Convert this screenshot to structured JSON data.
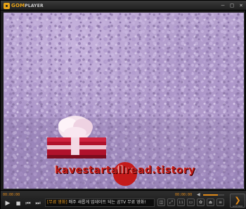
{
  "app": {
    "logo_main": "GOM",
    "logo_sub": "PLAYER"
  },
  "window_controls": {
    "minimize": "–",
    "maximize": "□",
    "close": "×"
  },
  "video": {
    "watermark": "kavestartallread.tistory"
  },
  "player": {
    "time_elapsed": "00:00:00",
    "time_total": "00:00:00",
    "volume_level": 0.7,
    "ticker_tag": "[무료 영화]",
    "ticker_text": "매주 새롭게 업데이트 되는 곰TV 무료 영화!",
    "buttons": {
      "play": "▶",
      "stop": "■",
      "prev": "⏮",
      "next": "⏭",
      "eject": "⏏",
      "menu": "≡",
      "big_play": "❯"
    },
    "ctrl_labels": [
      "◫",
      "⤢",
      "1:1",
      "▭",
      "✿",
      "⏏",
      "≡"
    ],
    "big_play_label": "GOM BOX"
  }
}
